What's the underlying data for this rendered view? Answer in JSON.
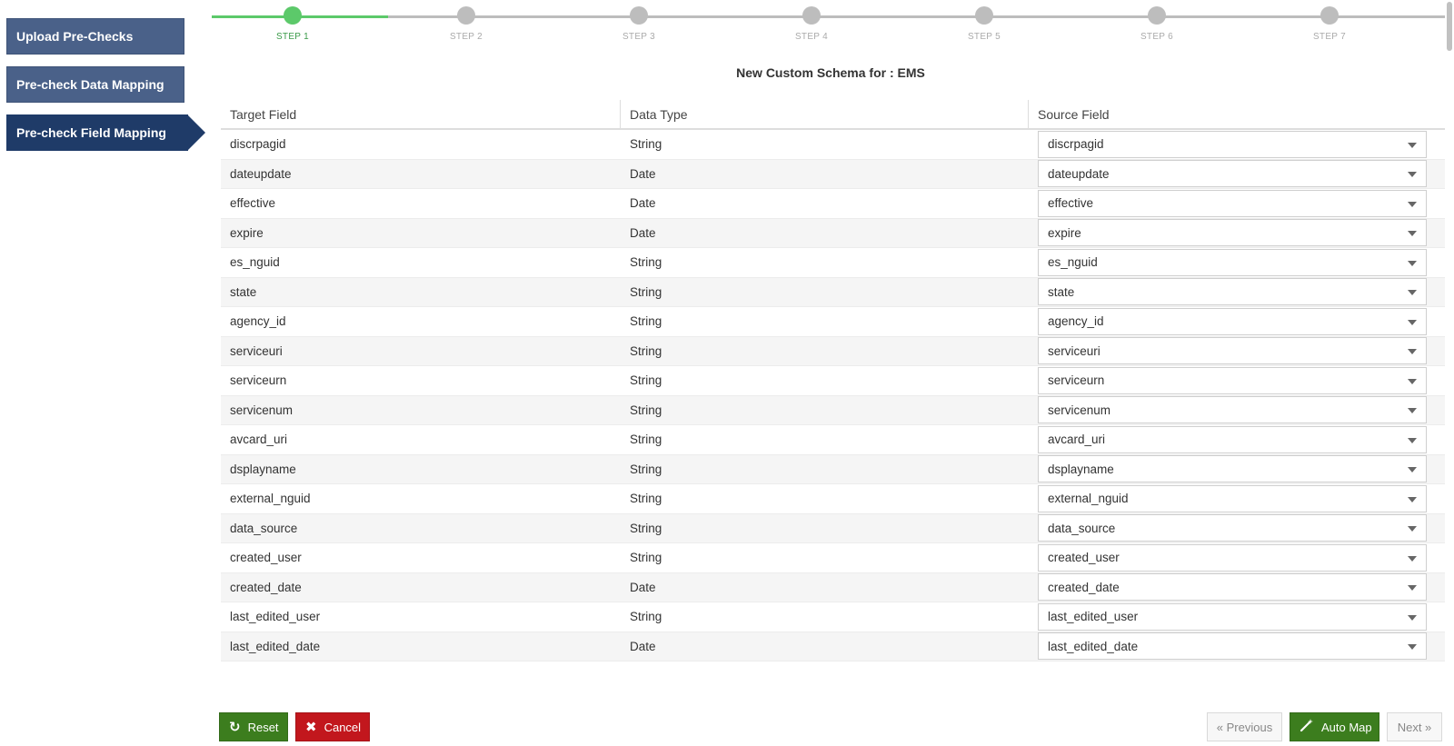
{
  "sidebar": {
    "items": [
      {
        "label": "Upload Pre-Checks"
      },
      {
        "label": "Pre-check Data Mapping"
      },
      {
        "label": "Pre-check Field Mapping"
      }
    ]
  },
  "stepper": {
    "steps": [
      "STEP 1",
      "STEP 2",
      "STEP 3",
      "STEP 4",
      "STEP 5",
      "STEP 6",
      "STEP 7"
    ],
    "current_step": 1
  },
  "schema_title": "New Custom Schema for : EMS",
  "table": {
    "headers": {
      "target": "Target Field",
      "type": "Data Type",
      "source": "Source Field"
    },
    "rows": [
      {
        "target": "discrpagid",
        "type": "String",
        "source": "discrpagid"
      },
      {
        "target": "dateupdate",
        "type": "Date",
        "source": "dateupdate"
      },
      {
        "target": "effective",
        "type": "Date",
        "source": "effective"
      },
      {
        "target": "expire",
        "type": "Date",
        "source": "expire"
      },
      {
        "target": "es_nguid",
        "type": "String",
        "source": "es_nguid"
      },
      {
        "target": "state",
        "type": "String",
        "source": "state"
      },
      {
        "target": "agency_id",
        "type": "String",
        "source": "agency_id"
      },
      {
        "target": "serviceuri",
        "type": "String",
        "source": "serviceuri"
      },
      {
        "target": "serviceurn",
        "type": "String",
        "source": "serviceurn"
      },
      {
        "target": "servicenum",
        "type": "String",
        "source": "servicenum"
      },
      {
        "target": "avcard_uri",
        "type": "String",
        "source": "avcard_uri"
      },
      {
        "target": "dsplayname",
        "type": "String",
        "source": "dsplayname"
      },
      {
        "target": "external_nguid",
        "type": "String",
        "source": "external_nguid"
      },
      {
        "target": "data_source",
        "type": "String",
        "source": "data_source"
      },
      {
        "target": "created_user",
        "type": "String",
        "source": "created_user"
      },
      {
        "target": "created_date",
        "type": "Date",
        "source": "created_date"
      },
      {
        "target": "last_edited_user",
        "type": "String",
        "source": "last_edited_user"
      },
      {
        "target": "last_edited_date",
        "type": "Date",
        "source": "last_edited_date"
      }
    ]
  },
  "buttons": {
    "reset": "Reset",
    "cancel": "Cancel",
    "previous": "« Previous",
    "auto_map": "Auto Map",
    "next": "Next »"
  },
  "icons": {
    "reset": "refresh-icon",
    "cancel": "close-icon",
    "auto_map": "magic-wand-icon",
    "dropdown": "chevron-down-icon"
  },
  "colors": {
    "sidebar": "#4a6189",
    "sidebar_active": "#1f3b68",
    "step_active": "#5cc96a",
    "step_inactive": "#bdbdbd",
    "btn_green": "#3c7d1e",
    "btn_red": "#c2171d"
  }
}
